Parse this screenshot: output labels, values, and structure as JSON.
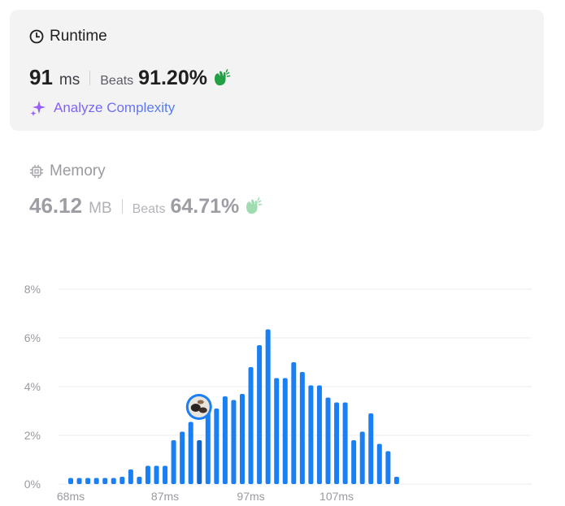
{
  "runtime": {
    "title": "Runtime",
    "value": "91",
    "unit": "ms",
    "beats_label": "Beats",
    "beats_value": "91.20%",
    "analyze_label": "Analyze Complexity"
  },
  "memory": {
    "title": "Memory",
    "value": "46.12",
    "unit": "MB",
    "beats_label": "Beats",
    "beats_value": "64.71%"
  },
  "colors": {
    "bar": "#1a7ff2",
    "highlight_bar": "#1264d0",
    "clap_active": "#22a043",
    "clap_inactive": "#9fdcb0"
  },
  "chart_data": {
    "type": "bar",
    "y_ticks": [
      "8%",
      "6%",
      "4%",
      "2%",
      "0%"
    ],
    "ylim": [
      0,
      8
    ],
    "x_tick_labels": [
      "68ms",
      "87ms",
      "97ms",
      "107ms"
    ],
    "x_tick_indices": [
      0,
      11,
      21,
      31
    ],
    "highlight_index": 15,
    "values": [
      0.25,
      0.25,
      0.25,
      0.25,
      0.25,
      0.25,
      0.3,
      0.6,
      0.3,
      0.75,
      0.75,
      0.75,
      1.8,
      2.15,
      2.55,
      1.8,
      3.1,
      3.1,
      3.6,
      3.45,
      3.7,
      4.8,
      5.7,
      6.35,
      4.35,
      4.35,
      5.0,
      4.6,
      4.05,
      4.05,
      3.55,
      3.35,
      3.35,
      1.8,
      2.15,
      2.9,
      1.65,
      1.35,
      0.3
    ]
  }
}
